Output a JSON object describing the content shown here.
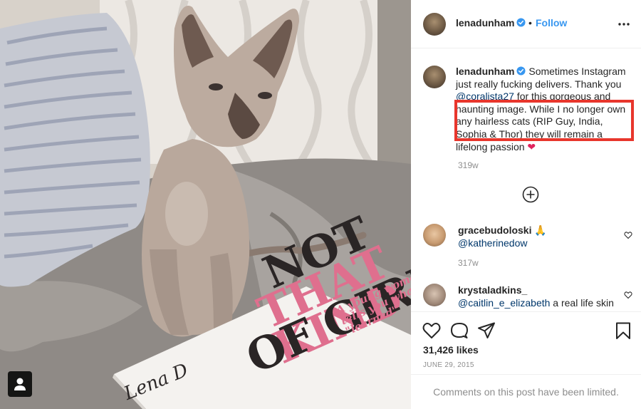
{
  "post": {
    "username": "lenadunham",
    "follow_label": "Follow",
    "separator": "•",
    "caption": {
      "text_before_mention": "Sometimes Instagram just really fucking delivers. Thank you ",
      "mention": "@coralista27",
      "text_after_mention": " for this gorgeous and haunting image. While I no longer own any hairless cats (RIP Guy, India, Sophia & Thor) they will remain a lifelong passion ",
      "emoji": "❤"
    },
    "caption_time": "319w",
    "likes": "31,426 likes",
    "date": "JUNE 29, 2015",
    "comments_limited": "Comments on this post have been limited."
  },
  "photo": {
    "book_line1": "NOT",
    "book_line2": "THAT KIND",
    "book_line3": "OF GIRL",
    "book_subtitle": "A young woman tells you what she's \"learned\"",
    "author": "Lena D"
  },
  "comments": [
    {
      "username": "gracebudoloski",
      "emoji": "🙏",
      "text": "@katherinedow",
      "time": "317w"
    },
    {
      "username": "krystaladkins_",
      "mention": "@caitlin_e_elizabeth",
      "text": " a real life skin"
    }
  ],
  "colors": {
    "verified": "#3897f0",
    "follow": "#3897f0",
    "mention": "#00376b",
    "highlight_box": "#e8362c",
    "heart": "#e0245e"
  },
  "icons": [
    "verified-badge-icon",
    "more-options-icon",
    "load-more-icon",
    "heart-icon",
    "comment-icon",
    "share-icon",
    "bookmark-icon",
    "user-tag-icon"
  ]
}
